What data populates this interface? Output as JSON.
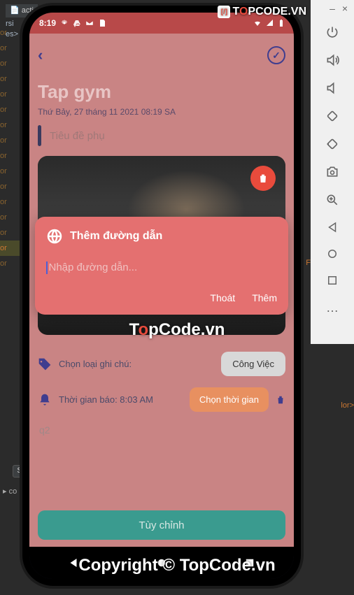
{
  "ide": {
    "tab": "acti",
    "line2": "rsi",
    "line3": "es>",
    "col": [
      "or",
      "or",
      "or",
      "or",
      "or",
      "or",
      "or",
      "or",
      "or",
      "or",
      "or",
      "or",
      "or",
      "or",
      "or",
      "or"
    ],
    "highlighted": 14,
    "bottom_co": "co",
    "sbtn": "S",
    "right1": "F",
    "lor": "lor>"
  },
  "emulator_controls": {
    "minimize": "–",
    "close": "×",
    "power": "power",
    "volume_up": "volume-up",
    "volume_down": "volume-down",
    "rotate_left": "rotate-left",
    "rotate_right": "rotate-right",
    "camera": "camera",
    "zoom": "zoom-in",
    "back": "back",
    "home": "home",
    "overview": "overview",
    "more": "…"
  },
  "statusbar": {
    "time": "8:19",
    "icons_left": [
      "gear",
      "drive",
      "gmail",
      "sd"
    ],
    "icons_right": [
      "wifi",
      "signal",
      "battery"
    ]
  },
  "app": {
    "back": "‹",
    "check": "✓",
    "title": "Tap gym",
    "date": "Thứ Bảy, 27 tháng 11 2021 08:19 SA",
    "subtitle_placeholder": "Tiêu đề phụ",
    "delete": "trash",
    "modal": {
      "title": "Thêm đường dẫn",
      "placeholder": "Nhập đường dẫn...",
      "cancel": "Thoát",
      "add": "Thêm"
    },
    "tag_row": {
      "label": "Chọn loại ghi chú:",
      "chip": "Công Việc"
    },
    "alarm_row": {
      "label": "Thời gian báo: 8:03 AM",
      "chip": "Chọn thời gian"
    },
    "q_input": "q2",
    "main_button": "Tùy chỉnh"
  },
  "nav": {
    "back": "◀",
    "home": "●",
    "overview": "■"
  },
  "watermark": {
    "top_brand_pre": "T",
    "top_brand_mid": "O",
    "top_brand_post": "PCODE",
    "top_vn": ".VN",
    "mid_pre": "T",
    "mid_o": "o",
    "mid_post": "pCode.vn",
    "bottom": "Copyright © TopCode.vn"
  }
}
